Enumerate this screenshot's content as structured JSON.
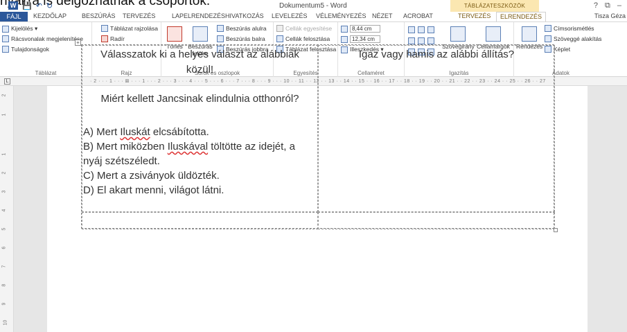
{
  "caption": "nyákra is delgozhatnak a csoportok.",
  "titlebar": {
    "document_title": "Dokumentum5 - Word",
    "contextual_header": "TÁBLÁZATESZKÖZÖK",
    "word_logo": "W",
    "qat_save": "💾",
    "qat_undo": "↶",
    "qat_redo": "↻",
    "help": "?",
    "minimize": "–",
    "restore": "⧉"
  },
  "tabs": {
    "file": "FÁJL",
    "items": [
      "KEZDŐLAP",
      "BESZÚRÁS",
      "TERVEZÉS",
      "LAPELRENDEZÉS",
      "HIVATKOZÁS",
      "LEVELEZÉS",
      "VÉLEMÉNYEZÉS",
      "NÉZET",
      "ACROBAT",
      "TERVEZÉS",
      "ELRENDEZÉS"
    ],
    "active": "ELRENDEZÉS",
    "user": "Tisza Géza"
  },
  "ribbon": {
    "table_group": {
      "label": "Táblázat",
      "select": "Kijelölés ▾",
      "gridlines": "Rácsvonalak megjelenítése",
      "properties": "Tulajdonságok"
    },
    "draw_group": {
      "label": "Rajz",
      "draw_table": "Táblázat rajzolása",
      "eraser": "Radír"
    },
    "rowscols_group": {
      "label": "Sorok és oszlopok",
      "delete": "Törlés",
      "insert_above": "Beszúrás felülre",
      "insert_below": "Beszúrás alulra",
      "insert_left": "Beszúrás balra",
      "insert_right": "Beszúrás jobbra"
    },
    "merge_group": {
      "label": "Egyesítés",
      "merge_cells": "Cellák egyesítése",
      "split_cells": "Cellák felosztása",
      "split_table": "Táblázat felosztása"
    },
    "cellsize_group": {
      "label": "Cellaméret",
      "height": "8,44 cm",
      "width": "12,34 cm",
      "autofit": "Illeszkedés ▾"
    },
    "align_group": {
      "label": "Igazítás",
      "text_direction": "Szövegirány",
      "cell_margins": "Cellamargók"
    },
    "data_group": {
      "label": "Adatok",
      "sort": "Rendezés",
      "repeat_header": "Címsorismétlés",
      "convert_text": "Szöveggé alakítás",
      "formula": "Képlet"
    }
  },
  "ruler": {
    "marks": "· 2 · · · 1 · · · ⊠ · · · 1 · · · 2 · · · 3 · · · 4 · · · 5 · · · 6 · · · 7 · · · 8 · · · 9 · · · 10 · · 11 · · 12 · · 13 · · 14 · · 15 · · 16 · · 17 · · 18 · · 19 · · 20 · · 21 · · 22 · · 23 · · 24 · · 25 · · 26 · · 27"
  },
  "vruler": [
    "2",
    "1",
    "1",
    "2",
    "3",
    "4",
    "5",
    "6",
    "7",
    "8",
    "9",
    "10"
  ],
  "document": {
    "cell1": {
      "question": "Válasszatok ki a helyes választ az alábbiak közül!",
      "prompt": "Miért kellett Jancsinak elindulnia otthonról?",
      "option_a_pre": "A) Mert ",
      "option_a_sq": "Iluskát",
      "option_a_post": " elcsábította.",
      "option_b_pre": "B) Mert miközben ",
      "option_b_sq": "Iluskával",
      "option_b_post": " töltötte az idejét, a",
      "option_b_cont": "nyáj szétszéledt.",
      "option_c": "C) Mert a zsiványok üldözték.",
      "option_d": "D) El akart menni, világot látni."
    },
    "cell2": {
      "question": "Igaz vagy hamis az alábbi állítás?"
    }
  }
}
